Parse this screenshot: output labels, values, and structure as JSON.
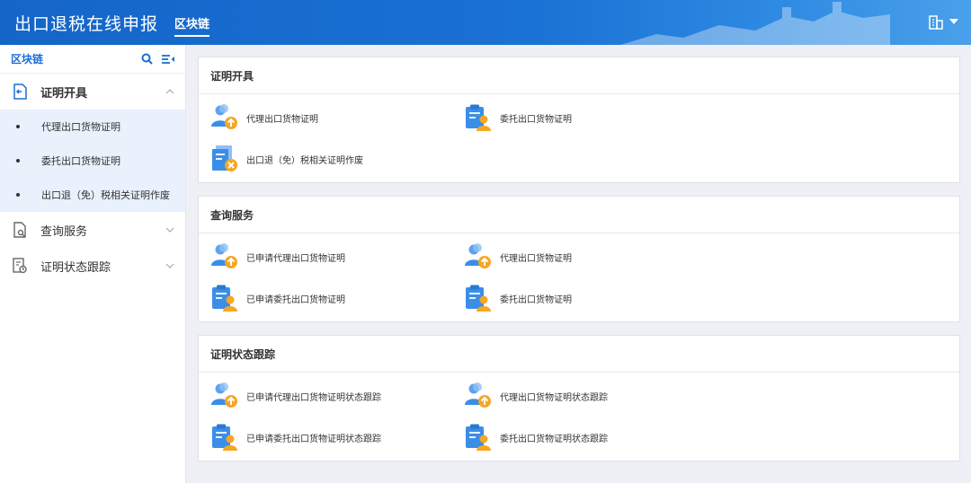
{
  "header": {
    "app_title": "出口退税在线申报",
    "active_tab": "区块链"
  },
  "sidebar": {
    "title": "区块链",
    "groups": [
      {
        "label": "证明开具",
        "icon": "certificate-issue-icon",
        "expanded": true,
        "items": [
          "代理出口货物证明",
          "委托出口货物证明",
          "出口退（免）税相关证明作废"
        ]
      },
      {
        "label": "查询服务",
        "icon": "query-service-icon",
        "expanded": false,
        "items": []
      },
      {
        "label": "证明状态跟踪",
        "icon": "status-tracking-icon",
        "expanded": false,
        "items": []
      }
    ]
  },
  "cards": [
    {
      "title": "证明开具",
      "items": [
        {
          "label": "代理出口货物证明",
          "icon": "person-upload-icon"
        },
        {
          "label": "委托出口货物证明",
          "icon": "clipboard-person-icon"
        },
        {
          "label": "出口退（免）税相关证明作废",
          "icon": "document-cancel-icon"
        }
      ]
    },
    {
      "title": "查询服务",
      "items": [
        {
          "label": "已申请代理出口货物证明",
          "icon": "person-upload-icon"
        },
        {
          "label": "代理出口货物证明",
          "icon": "person-upload-icon"
        },
        {
          "label": "已申请委托出口货物证明",
          "icon": "clipboard-person-icon"
        },
        {
          "label": "委托出口货物证明",
          "icon": "clipboard-person-icon"
        }
      ]
    },
    {
      "title": "证明状态跟踪",
      "items": [
        {
          "label": "已申请代理出口货物证明状态跟踪",
          "icon": "person-upload-icon"
        },
        {
          "label": "代理出口货物证明状态跟踪",
          "icon": "person-upload-icon"
        },
        {
          "label": "已申请委托出口货物证明状态跟踪",
          "icon": "clipboard-person-icon"
        },
        {
          "label": "委托出口货物证明状态跟踪",
          "icon": "clipboard-person-icon"
        }
      ]
    }
  ],
  "colors": {
    "brand_blue": "#1a6fd4",
    "icon_blue": "#3b8ee8",
    "icon_orange": "#f5a623",
    "submenu_bg": "#e8f1fc"
  }
}
